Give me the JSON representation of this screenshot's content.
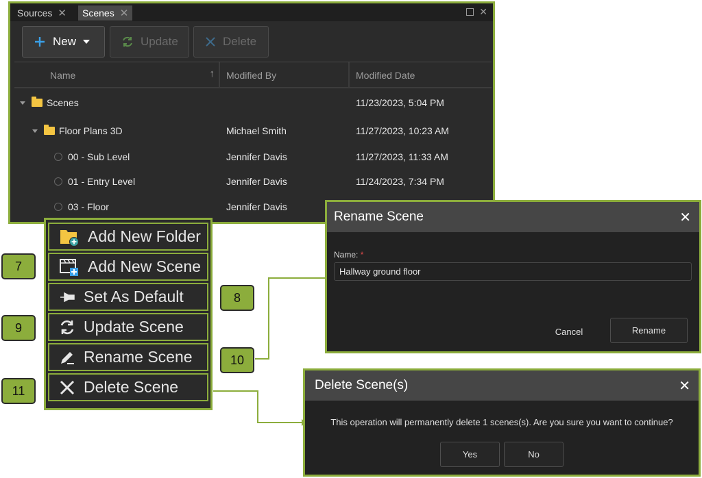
{
  "tabs": [
    {
      "label": "Sources",
      "active": false
    },
    {
      "label": "Scenes",
      "active": true
    }
  ],
  "toolbar": {
    "new_label": "New",
    "update_label": "Update",
    "delete_label": "Delete"
  },
  "columns": {
    "name": "Name",
    "modified_by": "Modified By",
    "modified_date": "Modified Date"
  },
  "rows": [
    {
      "type": "folder",
      "name": "Scenes",
      "modified_by": "",
      "modified_date": "11/23/2023, 5:04 PM"
    },
    {
      "type": "folder",
      "name": "Floor Plans 3D",
      "modified_by": "Michael Smith",
      "modified_date": "11/27/2023, 10:23 AM"
    },
    {
      "type": "scene",
      "name": "00 - Sub Level",
      "modified_by": "Jennifer Davis",
      "modified_date": "11/27/2023, 11:33 AM"
    },
    {
      "type": "scene",
      "name": "01 - Entry Level",
      "modified_by": "Jennifer Davis",
      "modified_date": "11/24/2023, 7:34 PM"
    },
    {
      "type": "scene",
      "name": "03 - Floor",
      "modified_by": "Jennifer Davis",
      "modified_date": ""
    }
  ],
  "context_menu": [
    {
      "label": "Add New Folder",
      "icon": "folder-add-icon"
    },
    {
      "label": "Add New Scene",
      "icon": "scene-add-icon"
    },
    {
      "label": "Set As Default",
      "icon": "pin-icon"
    },
    {
      "label": "Update Scene",
      "icon": "refresh-icon"
    },
    {
      "label": "Rename Scene",
      "icon": "pencil-icon"
    },
    {
      "label": "Delete Scene",
      "icon": "close-icon"
    }
  ],
  "callouts": [
    "7",
    "8",
    "9",
    "10",
    "11"
  ],
  "rename_dialog": {
    "title": "Rename Scene",
    "field_label": "Name:",
    "required_mark": "*",
    "value": "Hallway ground floor",
    "cancel_label": "Cancel",
    "rename_label": "Rename"
  },
  "delete_dialog": {
    "title": "Delete Scene(s)",
    "message": "This operation will permanently delete 1 scenes(s). Are you sure you want to continue?",
    "yes_label": "Yes",
    "no_label": "No"
  },
  "colors": {
    "accent": "#8cad3c",
    "panel_bg": "#2b2b2b",
    "dialog_bg": "#222222",
    "folder": "#f4c542",
    "new_plus": "#3aa0e8"
  }
}
